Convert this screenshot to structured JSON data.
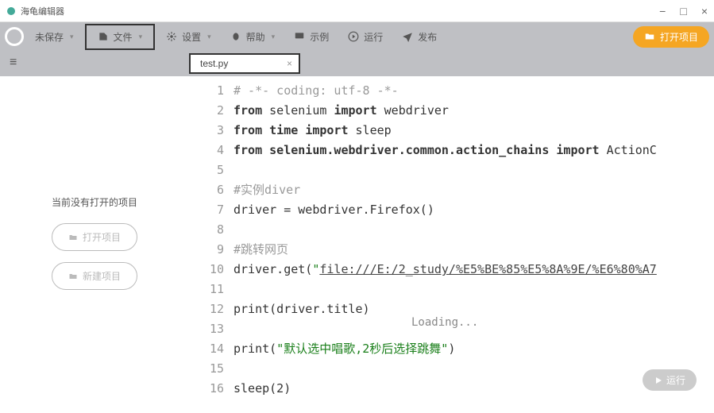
{
  "window": {
    "title": "海龟编辑器",
    "controls": {
      "min": "−",
      "max": "□",
      "close": "×"
    }
  },
  "toolbar": {
    "new": "未保存",
    "file": "文件",
    "settings": "设置",
    "help": "帮助",
    "examples": "示例",
    "run": "运行",
    "publish": "发布",
    "open_project": "打开项目"
  },
  "tab": {
    "name": "test.py",
    "close": "×"
  },
  "sidebar": {
    "msg": "当前没有打开的项目",
    "btn1": "打开项目",
    "btn2": "新建项目"
  },
  "code": {
    "lines": [
      {
        "n": "1",
        "t": "# -*- coding: utf-8 -*-",
        "cls": "cm"
      },
      {
        "n": "2",
        "segs": [
          [
            "from ",
            "kw"
          ],
          [
            "selenium ",
            ""
          ],
          [
            "import ",
            "kw"
          ],
          [
            "webdriver",
            ""
          ]
        ]
      },
      {
        "n": "3",
        "segs": [
          [
            "from ",
            "kw"
          ],
          [
            "time ",
            "kw"
          ],
          [
            "import ",
            "kw"
          ],
          [
            "sleep",
            ""
          ]
        ]
      },
      {
        "n": "4",
        "segs": [
          [
            "from ",
            "kw"
          ],
          [
            "selenium.webdriver.common.action_chains ",
            "kw"
          ],
          [
            "import ",
            "kw"
          ],
          [
            "ActionC",
            ""
          ]
        ]
      },
      {
        "n": "5",
        "t": ""
      },
      {
        "n": "6",
        "t": "#实例diver",
        "cls": "cm"
      },
      {
        "n": "7",
        "t": "driver = webdriver.Firefox()"
      },
      {
        "n": "8",
        "t": ""
      },
      {
        "n": "9",
        "t": "#跳转网页",
        "cls": "cm"
      },
      {
        "n": "10",
        "segs": [
          [
            "driver.get(",
            ""
          ],
          [
            "\"",
            "str"
          ],
          [
            "file:///E:/2_study/%E5%BE%85%E5%8A%9E/%E6%80%A7",
            "lnk"
          ]
        ]
      },
      {
        "n": "11",
        "t": ""
      },
      {
        "n": "12",
        "t": "print(driver.title)"
      },
      {
        "n": "13",
        "t": ""
      },
      {
        "n": "14",
        "segs": [
          [
            "print(",
            ""
          ],
          [
            "\"默认选中唱歌,2秒后选择跳舞\"",
            "str"
          ],
          [
            ")",
            ""
          ]
        ]
      },
      {
        "n": "15",
        "t": ""
      },
      {
        "n": "16",
        "t": "sleep(2)"
      }
    ]
  },
  "loading": "Loading...",
  "run_label": "运行"
}
